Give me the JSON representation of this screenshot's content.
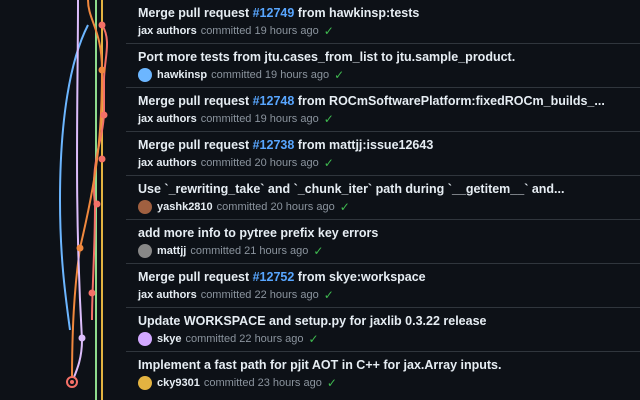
{
  "commits": [
    {
      "title_pre": "Merge pull request ",
      "pr": "#12749",
      "title_post": " from hawkinsp:tests",
      "author": "jax authors",
      "time": "committed 19 hours ago",
      "avatar": "none"
    },
    {
      "title_pre": "Port more tests from jtu.cases_from_list to jtu.sample_product.",
      "pr": "",
      "title_post": "",
      "author": "hawkinsp",
      "time": "committed 19 hours ago",
      "avatar": "#6cb6ff"
    },
    {
      "title_pre": "Merge pull request ",
      "pr": "#12748",
      "title_post": " from ROCmSoftwarePlatform:fixedROCm_builds_...",
      "author": "jax authors",
      "time": "committed 19 hours ago",
      "avatar": "none"
    },
    {
      "title_pre": "Merge pull request ",
      "pr": "#12738",
      "title_post": " from mattjj:issue12643",
      "author": "jax authors",
      "time": "committed 20 hours ago",
      "avatar": "none"
    },
    {
      "title_pre": "Use `_rewriting_take` and `_chunk_iter` path during `__getitem__` and...",
      "pr": "",
      "title_post": "",
      "author": "yashk2810",
      "time": "committed 20 hours ago",
      "avatar": "#a06040"
    },
    {
      "title_pre": "add more info to pytree prefix key errors",
      "pr": "",
      "title_post": "",
      "author": "mattjj",
      "time": "committed 21 hours ago",
      "avatar": "#888888"
    },
    {
      "title_pre": "Merge pull request ",
      "pr": "#12752",
      "title_post": " from skye:workspace",
      "author": "jax authors",
      "time": "committed 22 hours ago",
      "avatar": "none"
    },
    {
      "title_pre": "Update WORKSPACE and setup.py for jaxlib 0.3.22 release",
      "pr": "",
      "title_post": "",
      "author": "skye",
      "time": "committed 22 hours ago",
      "avatar": "#d2a8ff"
    },
    {
      "title_pre": "Implement a fast path for pjit AOT in C++ for jax.Array inputs.",
      "pr": "",
      "title_post": "",
      "author": "cky9301",
      "time": "committed 23 hours ago",
      "avatar": "#e3b341"
    }
  ],
  "colors": {
    "accent_link": "#58a6ff",
    "check": "#3fb950",
    "line_red": "#f47067",
    "line_orange": "#f0883e",
    "line_yellow": "#e3b341",
    "line_blue": "#6cb6ff",
    "line_purple": "#dcbdfb",
    "line_green": "#8ddb8c"
  },
  "icons": {
    "status": "check-icon"
  }
}
